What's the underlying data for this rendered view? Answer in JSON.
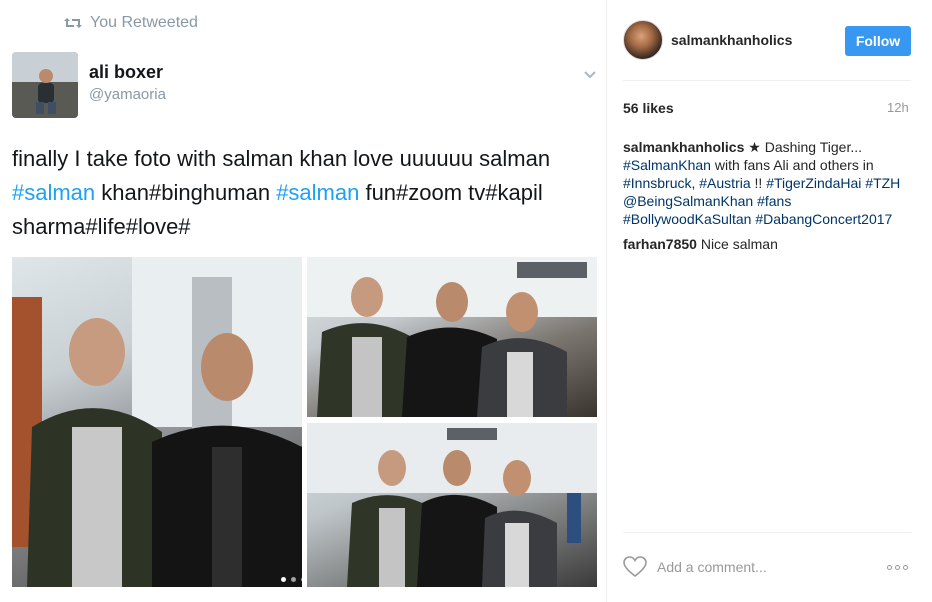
{
  "tweet": {
    "retweet_label": "You Retweeted",
    "name": "ali boxer",
    "handle": "@yamaoria",
    "text_parts": [
      {
        "text": "finally I take foto with salman khan love uuuuuu salman ",
        "type": "plain"
      },
      {
        "text": "#salman",
        "type": "hash"
      },
      {
        "text": " khan#binghuman ",
        "type": "plain"
      },
      {
        "text": "#salman",
        "type": "hash"
      },
      {
        "text": " fun#zoom tv#kapil sharma#life#love#",
        "type": "plain"
      }
    ]
  },
  "post": {
    "username": "salmankhanholics",
    "follow_label": "Follow",
    "likes": "56 likes",
    "time": "12h",
    "caption_user": "salmankhanholics",
    "caption_parts": [
      {
        "text": " ★ Dashing Tiger... ",
        "type": "plain"
      },
      {
        "text": "#SalmanKhan",
        "type": "tag"
      },
      {
        "text": " with fans Ali and others in ",
        "type": "plain"
      },
      {
        "text": "#Innsbruck",
        "type": "tag"
      },
      {
        "text": ", ",
        "type": "plain"
      },
      {
        "text": "#Austria",
        "type": "tag"
      },
      {
        "text": " !! ",
        "type": "plain"
      },
      {
        "text": "#TigerZindaHai",
        "type": "tag"
      },
      {
        "text": " ",
        "type": "plain"
      },
      {
        "text": "#TZH",
        "type": "tag"
      },
      {
        "text": " ",
        "type": "plain"
      },
      {
        "text": "@BeingSalmanKhan",
        "type": "tag"
      },
      {
        "text": " ",
        "type": "plain"
      },
      {
        "text": "#fans",
        "type": "tag"
      },
      {
        "text": " ",
        "type": "plain"
      },
      {
        "text": "#BollywoodKaSultan",
        "type": "tag"
      },
      {
        "text": " ",
        "type": "plain"
      },
      {
        "text": "#DabangConcert2017",
        "type": "tag"
      }
    ],
    "comment_user": "farhan7850",
    "comment_text": " Nice salman",
    "add_comment_placeholder": "Add a comment..."
  },
  "colors": {
    "follow_bg": "#3897f0",
    "tweet_hashtag": "#1da1f2",
    "ig_tag": "#003569"
  }
}
